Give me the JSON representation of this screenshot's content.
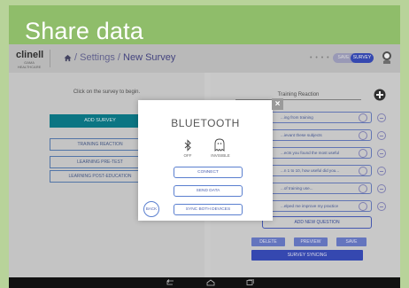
{
  "banner": {
    "title": "Share data"
  },
  "topbar": {
    "logo": "clinell",
    "logo_sub": "GAMA HEALTHCARE",
    "breadcrumb_settings": "/ Settings",
    "breadcrumb_sep": " / ",
    "breadcrumb_page": "New Survey",
    "dots": "• • • •",
    "save_label": "SAVE",
    "survey_label": "SURVEY"
  },
  "left": {
    "hint": "Click on the survey to begin.",
    "add_survey": "ADD SURVEY",
    "buttons": [
      "TRAINING REACTION",
      "LEARNING PRE-TEST",
      "LEARNING POST-EDUCATION"
    ]
  },
  "right": {
    "title": "Training Reaction",
    "questions": [
      "...ing from training",
      "...ievant these subjects",
      "...ects you found the most useful",
      "...n 1 to 10, how useful did you...",
      "...of training use...",
      "...elped me improve my practice"
    ],
    "add_question": "ADD NEW QUESTION",
    "delete": "DELETE",
    "preview": "PREVIEW",
    "save": "SAVE",
    "syncing": "SURVEY SYNCING"
  },
  "modal": {
    "close": "×",
    "title": "BLUETOOTH",
    "off_label": "OFF",
    "invisible_label": "INVISIBLE",
    "connect": "CONNECT",
    "send_data": "SEND DATA",
    "sync_both": "SYNC BOTH DEVICES",
    "back": "BACK"
  },
  "colors": {
    "frame": "#b8d39a",
    "banner": "#8fbd6a",
    "teal": "#0d7f8f",
    "blue": "#3a4fbf"
  },
  "icons": [
    "home-icon",
    "avatar-icon",
    "plus-circle-icon",
    "bluetooth-icon",
    "ghost-icon",
    "close-icon",
    "back-nav-icon",
    "home-nav-icon",
    "recents-nav-icon"
  ]
}
